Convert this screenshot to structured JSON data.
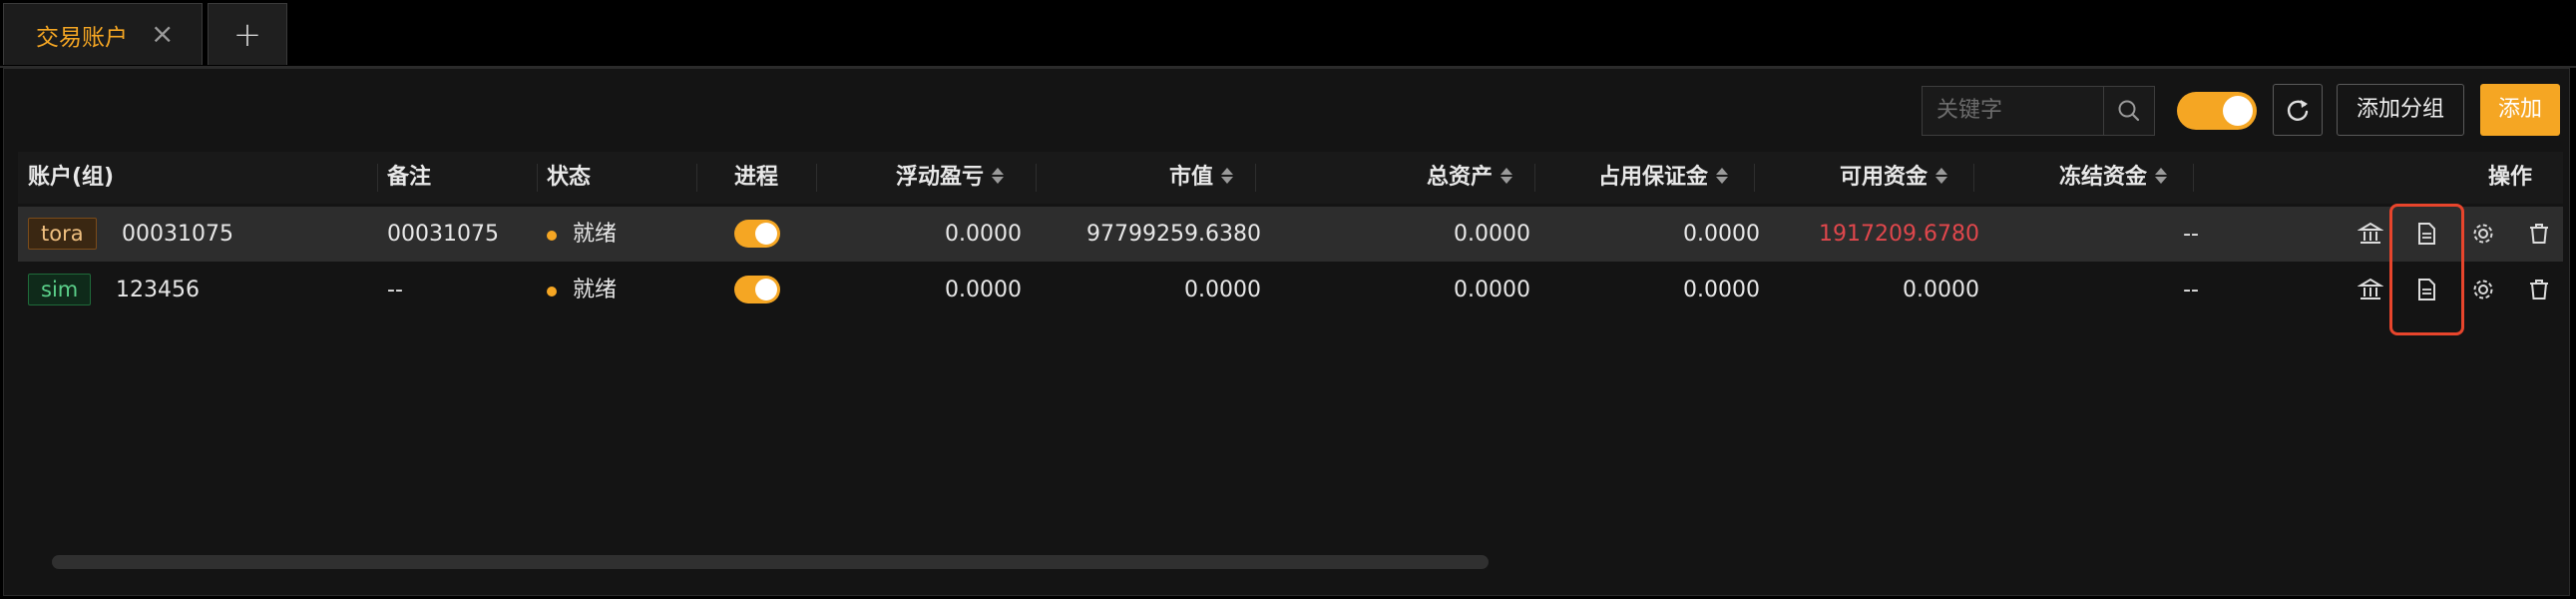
{
  "tabs": [
    {
      "label": "交易账户",
      "active": true
    }
  ],
  "tab_close_symbol": "×",
  "tab_add_symbol": "+",
  "toolbar": {
    "search_placeholder": "关键字",
    "auto_toggle_on": true,
    "add_group_label": "添加分组",
    "add_label": "添加"
  },
  "table": {
    "columns": {
      "account": "账户(组)",
      "remark": "备注",
      "status": "状态",
      "process": "进程",
      "float_pnl": "浮动盈亏",
      "market_value": "市值",
      "total_assets": "总资产",
      "margin": "占用保证金",
      "available": "可用资金",
      "frozen": "冻结资金",
      "ops": "操作"
    },
    "rows": [
      {
        "tag": "tora",
        "account": "00031075",
        "remark": "00031075",
        "status": "就绪",
        "process_on": true,
        "float_pnl": "0.0000",
        "market_value": "97799259.6380",
        "total_assets": "0.0000",
        "margin": "0.0000",
        "available": "1917209.6780",
        "frozen": "--"
      },
      {
        "tag": "sim",
        "account": "123456",
        "remark": "--",
        "status": "就绪",
        "process_on": true,
        "float_pnl": "0.0000",
        "market_value": "0.0000",
        "total_assets": "0.0000",
        "margin": "0.0000",
        "available": "0.0000",
        "frozen": "--"
      }
    ]
  },
  "colors": {
    "accent": "#f5a623",
    "negative": "#e0474c",
    "highlight_box": "#e8452c"
  },
  "icons": [
    "close-icon",
    "plus-icon",
    "search-icon",
    "refresh-icon",
    "bank-icon",
    "document-icon",
    "gear-icon",
    "trash-icon"
  ]
}
